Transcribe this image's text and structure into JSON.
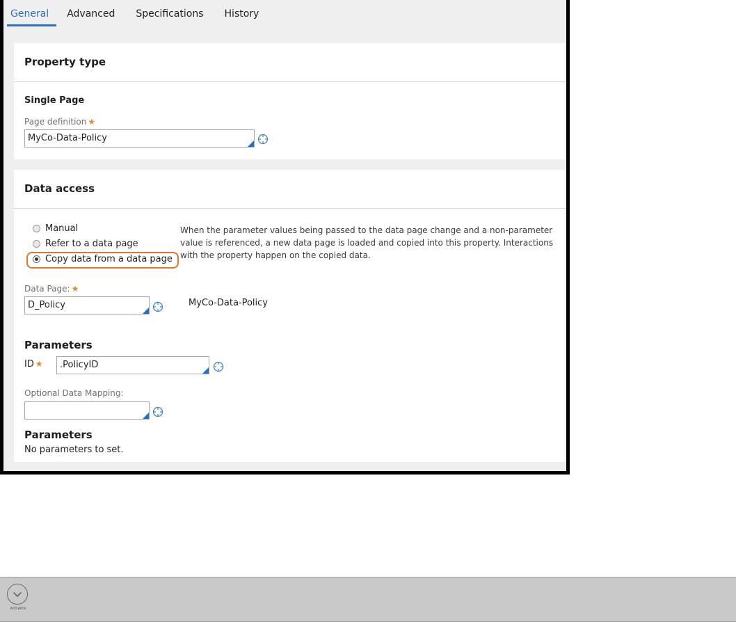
{
  "tabs": [
    {
      "label": "General",
      "active": true
    },
    {
      "label": "Advanced",
      "active": false
    },
    {
      "label": "Specifications",
      "active": false
    },
    {
      "label": "History",
      "active": false
    }
  ],
  "property_type": {
    "header": "Property type",
    "subheader": "Single Page",
    "page_definition_label": "Page definition",
    "page_definition_value": "MyCo-Data-Policy",
    "required_marker": "★"
  },
  "data_access": {
    "header": "Data access",
    "options": [
      {
        "label": "Manual",
        "checked": false
      },
      {
        "label": "Refer to a data page",
        "checked": false
      },
      {
        "label": "Copy data from a data page",
        "checked": true
      }
    ],
    "help_text": "When the parameter values being passed to the data page change and a non-parameter value is referenced, a new data page is loaded and copied into this property. Interactions with the property happen on the copied data.",
    "data_page_label": "Data Page:",
    "data_page_value": "D_Policy",
    "data_page_class": "MyCo-Data-Policy",
    "parameters_title": "Parameters",
    "param_id_label": "ID",
    "param_id_value": ".PolicyID",
    "optional_mapping_label": "Optional Data Mapping:",
    "optional_mapping_value": "",
    "parameters_title_2": "Parameters",
    "no_params_text": "No parameters to set."
  },
  "answer": {
    "label": "ANSWER"
  },
  "colors": {
    "accent": "#2a72c3",
    "highlight": "#e5762c",
    "required": "#e5882b",
    "field_corner": "#1f6fd1"
  }
}
